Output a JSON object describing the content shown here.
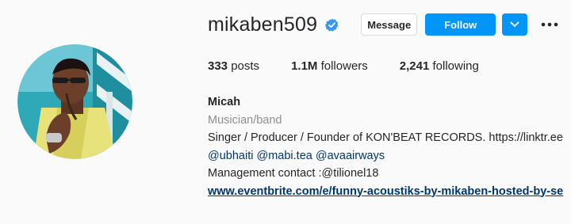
{
  "profile": {
    "username": "mikaben509",
    "verified_icon": "verified-badge-icon"
  },
  "actions": {
    "message_label": "Message",
    "follow_label": "Follow",
    "dropdown_icon": "chevron-down-icon",
    "more_icon": "more-options-icon"
  },
  "stats": {
    "posts_count": "333",
    "posts_label": "posts",
    "followers_count": "1.1M",
    "followers_label": "followers",
    "following_count": "2,241",
    "following_label": "following"
  },
  "bio": {
    "name": "Micah",
    "category": "Musician/band",
    "line1": "Singer / Producer / Founder of KON'BEAT RECORDS. https://linktr.ee",
    "mentions": [
      "@ubhaiti",
      "@mabi.tea",
      "@avaairways"
    ],
    "contact": "Management contact :@tilionel18",
    "link": "www.eventbrite.com/e/funny-acoustiks-by-mikaben-hosted-by-se"
  },
  "colors": {
    "accent": "#0095f6",
    "background": "#fafafa",
    "link": "#00376b",
    "muted": "#8e8e8e"
  }
}
